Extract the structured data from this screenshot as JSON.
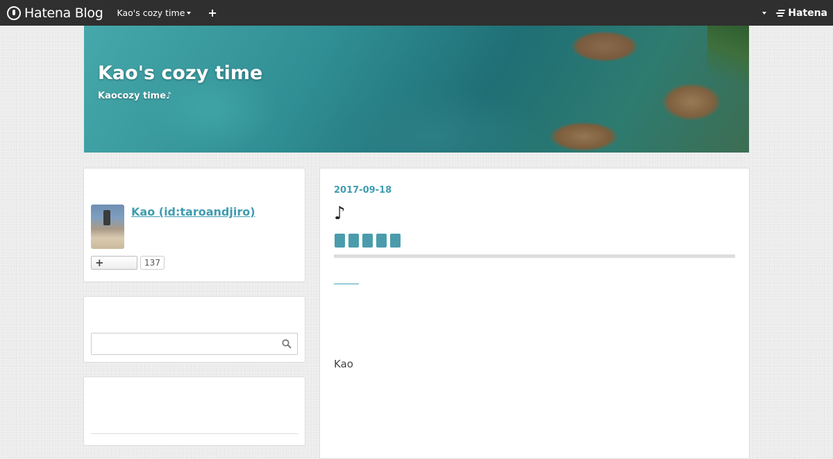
{
  "globalbar": {
    "logo_text": "Hatena Blog",
    "blog_menu_label": "Kao's cozy time",
    "add_label": "+",
    "brand_label": "Hatena"
  },
  "header": {
    "title": "Kao's cozy time",
    "description": "Kaocozy time♪"
  },
  "profile": {
    "name": "Kao (id:taroandjiro)",
    "follow_plus": "+",
    "follower_count": "137"
  },
  "search": {
    "placeholder": ""
  },
  "entry": {
    "date": "2017-09-18",
    "title": "♪",
    "category_count": 5,
    "body_text": "Kao"
  },
  "colors": {
    "accent": "#3f9cb0",
    "bar": "#2f2f2f",
    "category": "#4a9cad"
  }
}
